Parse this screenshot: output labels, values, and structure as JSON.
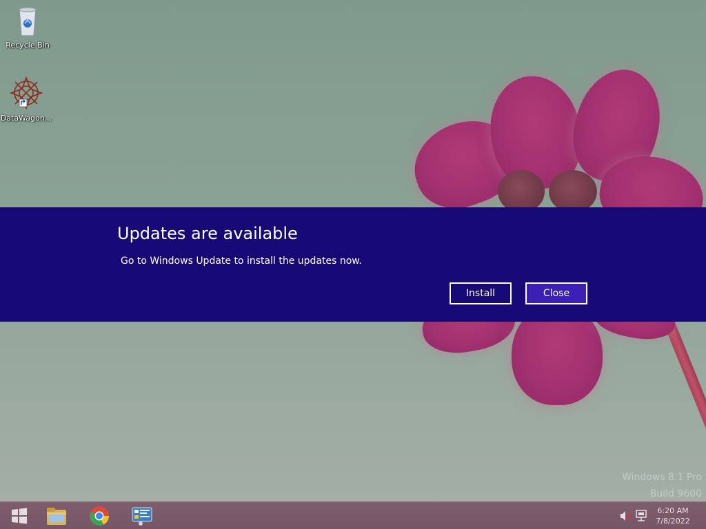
{
  "desktop": {
    "icons": [
      {
        "label": "Recycle Bin",
        "icon": "recycle-bin-icon"
      },
      {
        "label": "DataWagon...",
        "icon": "datawagon-shortcut-icon"
      }
    ],
    "watermark": {
      "line1": "Windows 8.1 Pro",
      "line2": "Build 9600"
    }
  },
  "notification": {
    "title": "Updates are available",
    "message": "Go to Windows Update to install the updates now.",
    "install_label": "Install",
    "close_label": "Close",
    "background": "#170975",
    "accent": "#3c1fb4"
  },
  "taskbar": {
    "items": [
      {
        "icon": "windows-start-icon"
      },
      {
        "icon": "file-explorer-icon"
      },
      {
        "icon": "chrome-icon"
      },
      {
        "icon": "control-panel-icon"
      }
    ],
    "tray": {
      "volume_icon": "speaker-muted-icon",
      "network_icon": "network-icon",
      "time": "6:20 AM",
      "date": "7/8/2022"
    }
  }
}
